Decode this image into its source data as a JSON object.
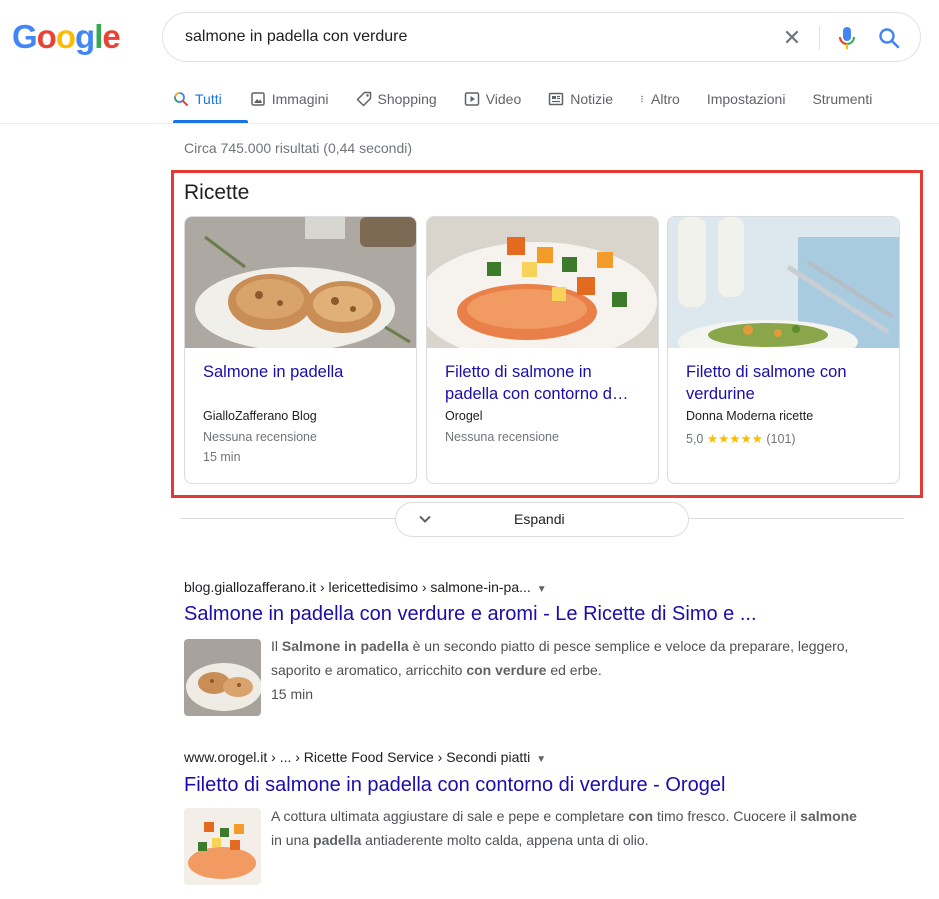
{
  "logo": {
    "letters": [
      "G",
      "o",
      "o",
      "g",
      "l",
      "e"
    ]
  },
  "search": {
    "query": "salmone in padella con verdure"
  },
  "tabs": [
    {
      "label": "Tutti",
      "icon": "search-icon"
    },
    {
      "label": "Immagini",
      "icon": "image-icon"
    },
    {
      "label": "Shopping",
      "icon": "tag-icon"
    },
    {
      "label": "Video",
      "icon": "play-icon"
    },
    {
      "label": "Notizie",
      "icon": "news-icon"
    },
    {
      "label": "Altro",
      "icon": "more-vert-icon"
    },
    {
      "label": "Impostazioni"
    },
    {
      "label": "Strumenti"
    }
  ],
  "stats": "Circa 745.000 risultati (0,44 secondi)",
  "recipes": {
    "title": "Ricette",
    "cards": [
      {
        "title": "Salmone in padella",
        "source": "GialloZafferano Blog",
        "meta1": "Nessuna recensione",
        "meta2": "15 min"
      },
      {
        "title": "Filetto di salmone in padella con contorno d…",
        "source": "Orogel",
        "meta1": "Nessuna recensione"
      },
      {
        "title": "Filetto di salmone con verdurine",
        "source": "Donna Moderna ricette",
        "rating": "5,0",
        "stars": "★★★★★",
        "reviews": "(101)"
      }
    ],
    "expand_label": "Espandi"
  },
  "results": [
    {
      "cite": "blog.giallozafferano.it › lericettedisimo › salmone-in-pa...",
      "title": "Salmone in padella con verdure e aromi - Le Ricette di Simo e ...",
      "snippet_parts": [
        "Il ",
        "Salmone in padella",
        " è un secondo piatto di pesce semplice e veloce da preparare, leggero, saporito e aromatico, arricchito ",
        "con verdure",
        " ed erbe."
      ],
      "extra": "15 min"
    },
    {
      "cite": "www.orogel.it › ... › Ricette Food Service › Secondi piatti",
      "title": "Filetto di salmone in padella con contorno di verdure - Orogel",
      "snippet_parts": [
        "A cottura ultimata aggiustare di sale e pepe e completare ",
        "con",
        " timo fresco. Cuocere il ",
        "salmone",
        " in una ",
        "padella",
        " antiaderente molto calda, appena unta di olio."
      ]
    }
  ],
  "colors": {
    "link": "#1a0dab",
    "accent": "#1a73e8",
    "highlight_box": "#e53935",
    "stars": "#fbbc04"
  }
}
